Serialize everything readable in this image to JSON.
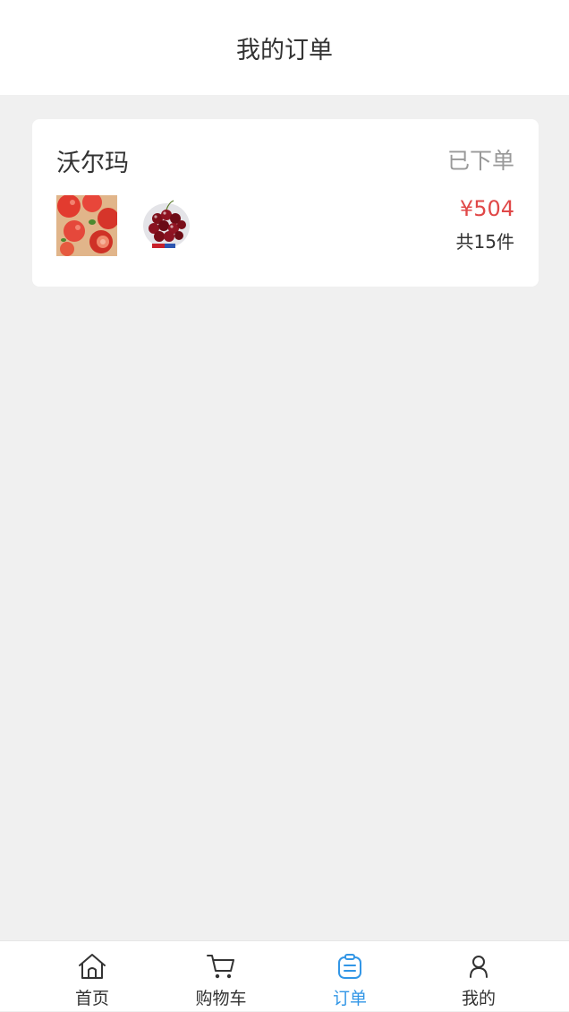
{
  "header": {
    "title": "我的订单"
  },
  "orders": [
    {
      "store": "沃尔玛",
      "status": "已下单",
      "price": "¥504",
      "count": "共15件",
      "items": [
        {
          "name": "tomato"
        },
        {
          "name": "cherry"
        }
      ]
    }
  ],
  "tabbar": {
    "items": [
      {
        "label": "首页",
        "icon": "home-icon"
      },
      {
        "label": "购物车",
        "icon": "cart-icon"
      },
      {
        "label": "订单",
        "icon": "order-icon",
        "active": true
      },
      {
        "label": "我的",
        "icon": "user-icon"
      }
    ]
  },
  "colors": {
    "accent": "#3296e6",
    "price": "#e04848",
    "status": "#999999",
    "background": "#f0f0f0"
  }
}
